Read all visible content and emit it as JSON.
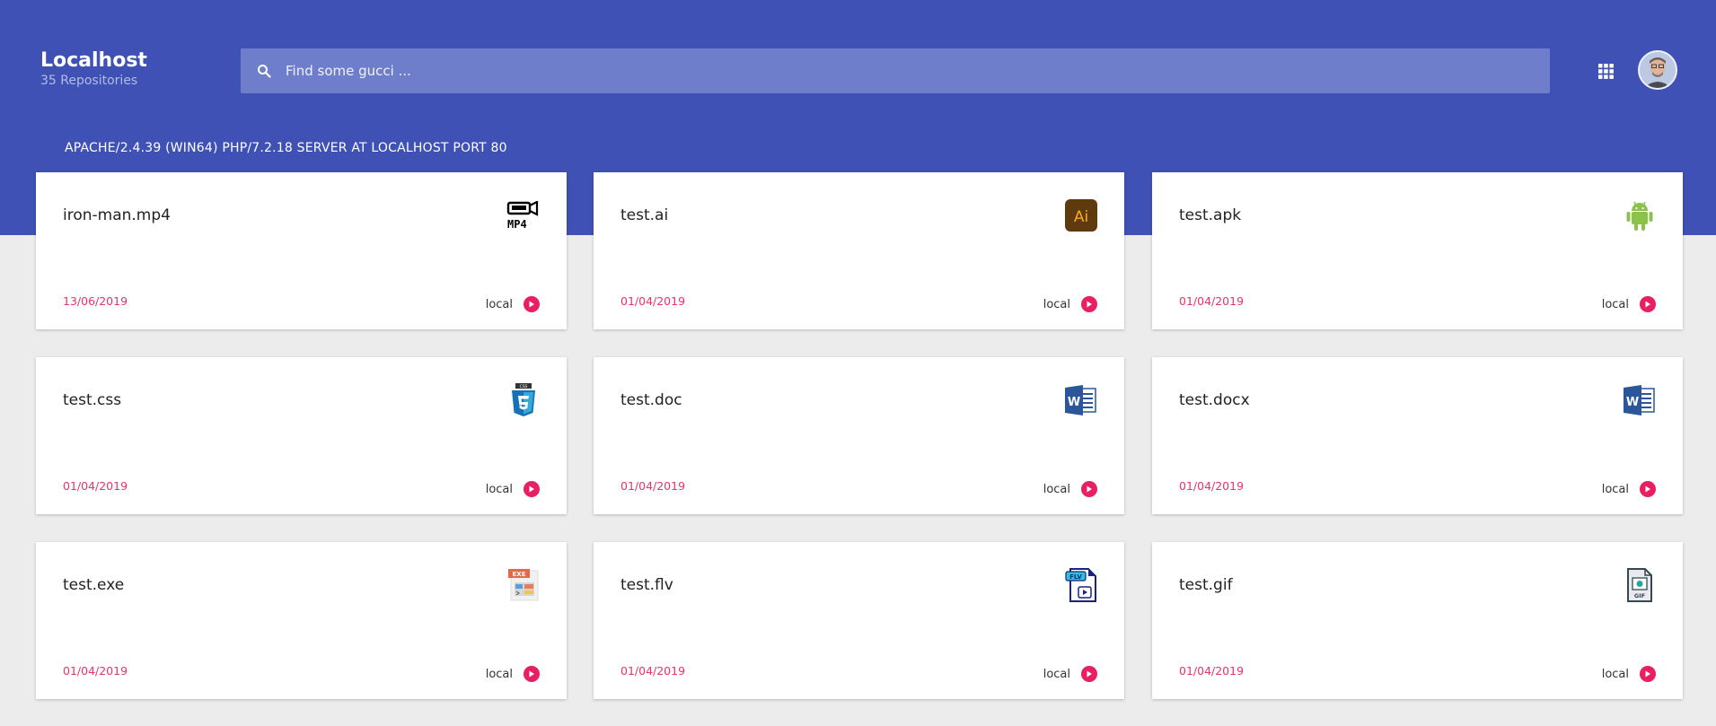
{
  "header": {
    "title": "Localhost",
    "subtitle": "35 Repositories",
    "search_placeholder": "Find some gucci ...",
    "apps_icon": "apps-grid-icon",
    "avatar_icon": "user-avatar"
  },
  "server_line": "APACHE/2.4.39 (WIN64) PHP/7.2.18 SERVER AT LOCALHOST PORT 80",
  "colors": {
    "primary": "#3f51b5",
    "search_bg": "#6f7ecb",
    "background": "#ececec",
    "accent": "#e91e63",
    "date": "#e8336b"
  },
  "files": [
    {
      "name": "iron-man.mp4",
      "date": "13/06/2019",
      "location": "local",
      "icon": "mp4-file-icon"
    },
    {
      "name": "test.ai",
      "date": "01/04/2019",
      "location": "local",
      "icon": "illustrator-file-icon"
    },
    {
      "name": "test.apk",
      "date": "01/04/2019",
      "location": "local",
      "icon": "android-icon"
    },
    {
      "name": "test.css",
      "date": "01/04/2019",
      "location": "local",
      "icon": "css3-file-icon"
    },
    {
      "name": "test.doc",
      "date": "01/04/2019",
      "location": "local",
      "icon": "word-doc-icon"
    },
    {
      "name": "test.docx",
      "date": "01/04/2019",
      "location": "local",
      "icon": "word-docx-icon"
    },
    {
      "name": "test.exe",
      "date": "01/04/2019",
      "location": "local",
      "icon": "exe-file-icon"
    },
    {
      "name": "test.flv",
      "date": "01/04/2019",
      "location": "local",
      "icon": "flv-file-icon"
    },
    {
      "name": "test.gif",
      "date": "01/04/2019",
      "location": "local",
      "icon": "gif-file-icon"
    }
  ],
  "icon_text": {
    "mp4": "MP4",
    "ai": "Ai",
    "css": "CSS",
    "doc": "W",
    "docx": "W",
    "exe": "EXE",
    "flv": "FLV",
    "gif": "GIF"
  }
}
